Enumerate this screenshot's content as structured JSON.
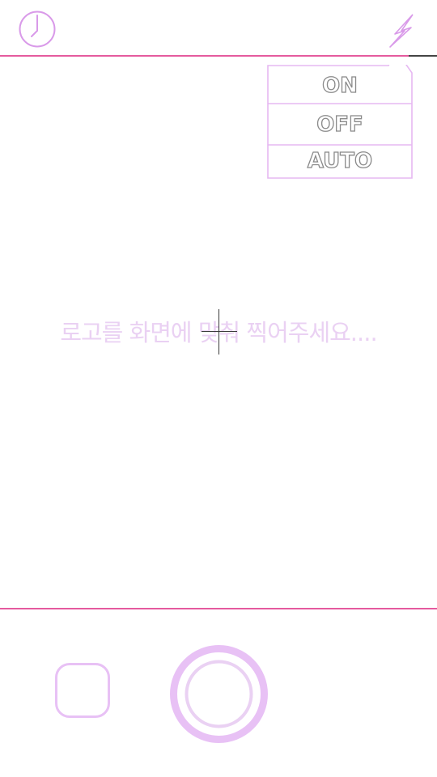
{
  "topbar": {
    "timer_icon": "clock-icon",
    "flash_icon": "lightning-bolt-icon"
  },
  "flash_menu": {
    "options": [
      "ON",
      "OFF",
      "AUTO"
    ]
  },
  "viewfinder": {
    "hint": "로고를 화면에 맞춰 찍어주세요...."
  },
  "bottombar": {
    "gallery_icon": "rounded-square-icon",
    "shutter_icon": "shutter-ring-icon"
  },
  "colors": {
    "accent_line": "#e55a9e",
    "icon_lilac": "#e8c1f5",
    "hint_text": "#ead1f3",
    "menu_border": "#e6b8f2",
    "menu_text_stroke": "#8a8a8a"
  }
}
